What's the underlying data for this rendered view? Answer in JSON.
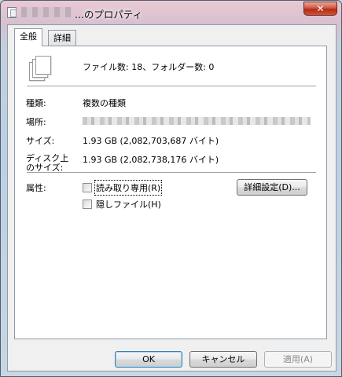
{
  "window": {
    "title": "...のプロパティ",
    "close_label": "✕",
    "title_icon": "document-icon"
  },
  "tabs": [
    {
      "label": "全般",
      "active": true
    },
    {
      "label": "詳細",
      "active": false
    }
  ],
  "general": {
    "files_icon": "multiple-files-icon",
    "summary": "ファイル数: 18、フォルダー数: 0",
    "type_label": "種類:",
    "type_value": "複数の種類",
    "location_label": "場所:",
    "size_label": "サイズ:",
    "size_value": "1.93 GB (2,082,703,687 バイト)",
    "size_on_disk_label_line1": "ディスク上",
    "size_on_disk_label_line2": "のサイズ:",
    "size_on_disk_value": "1.93 GB (2,082,738,176 バイト)",
    "attributes_label": "属性:",
    "readonly_label": "読み取り専用(R)",
    "readonly_checked": false,
    "hidden_label": "隠しファイル(H)",
    "hidden_checked": false,
    "advanced_button": "詳細設定(D)..."
  },
  "footer": {
    "ok": "OK",
    "cancel": "キャンセル",
    "apply": "適用(A)"
  },
  "colors": {
    "accent_border": "#3c7fb1",
    "close_red": "#c9543a"
  }
}
